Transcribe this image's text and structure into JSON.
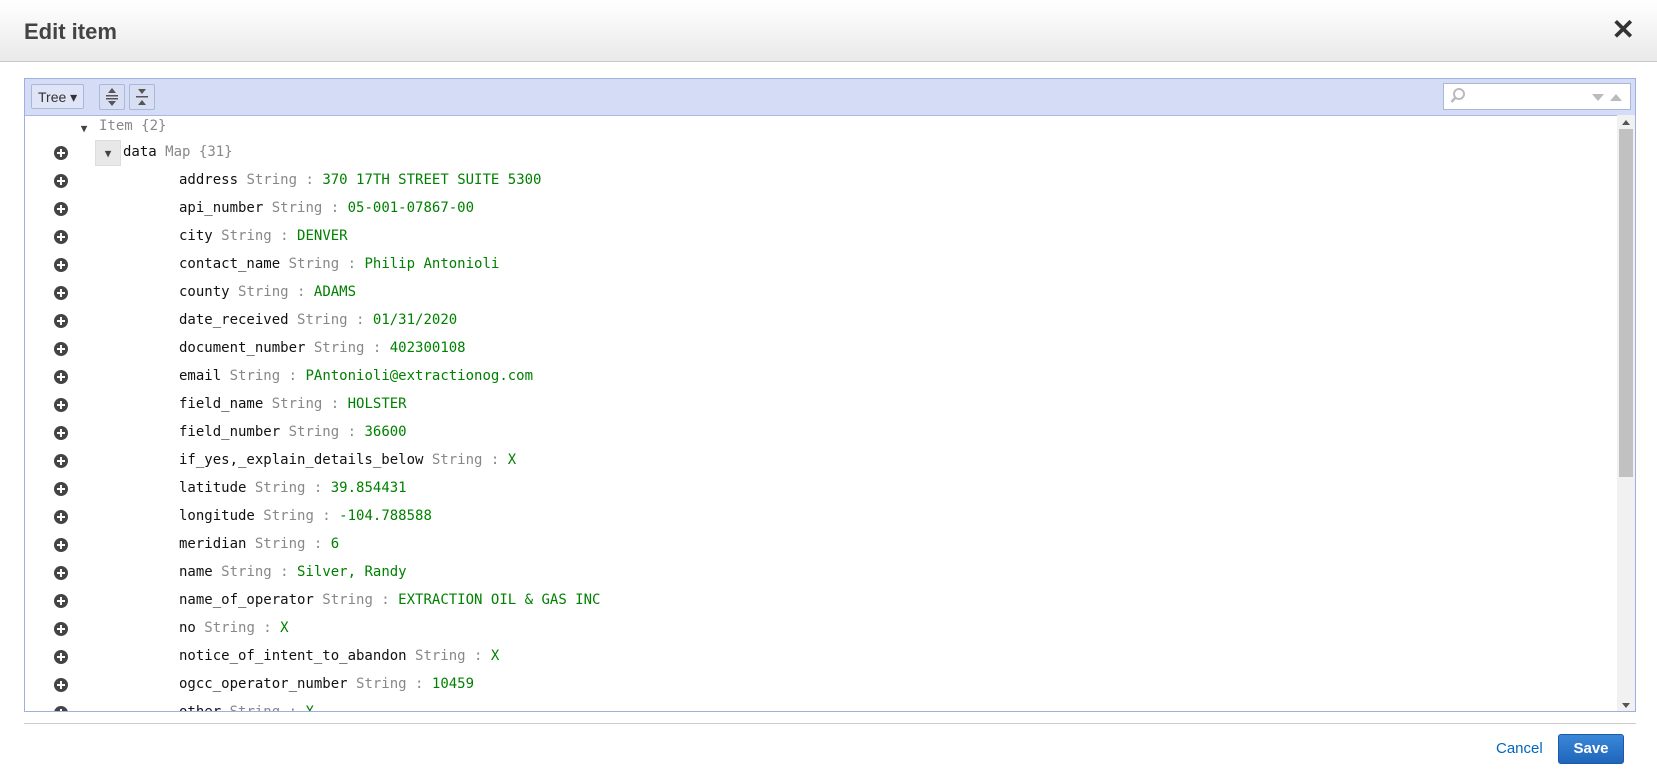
{
  "dialog": {
    "title": "Edit item",
    "close_label": "✕"
  },
  "toolbar": {
    "mode_label": "Tree ▾",
    "search_placeholder": ""
  },
  "tree": {
    "root": {
      "name": "Item",
      "count": "{2}"
    },
    "data_node": {
      "name": "data",
      "type": "Map",
      "count": "{31}"
    },
    "fields": [
      {
        "key": "address",
        "type": "String",
        "value": "370 17TH STREET SUITE 5300"
      },
      {
        "key": "api_number",
        "type": "String",
        "value": "05-001-07867-00"
      },
      {
        "key": "city",
        "type": "String",
        "value": "DENVER"
      },
      {
        "key": "contact_name",
        "type": "String",
        "value": "Philip Antonioli"
      },
      {
        "key": "county",
        "type": "String",
        "value": "ADAMS"
      },
      {
        "key": "date_received",
        "type": "String",
        "value": "01/31/2020"
      },
      {
        "key": "document_number",
        "type": "String",
        "value": "402300108"
      },
      {
        "key": "email",
        "type": "String",
        "value": "PAntonioli@extractionog.com"
      },
      {
        "key": "field_name",
        "type": "String",
        "value": "HOLSTER"
      },
      {
        "key": "field_number",
        "type": "String",
        "value": "36600"
      },
      {
        "key": "if_yes,_explain_details_below",
        "type": "String",
        "value": "X"
      },
      {
        "key": "latitude",
        "type": "String",
        "value": "39.854431"
      },
      {
        "key": "longitude",
        "type": "String",
        "value": "-104.788588"
      },
      {
        "key": "meridian",
        "type": "String",
        "value": "6"
      },
      {
        "key": "name",
        "type": "String",
        "value": "Silver, Randy"
      },
      {
        "key": "name_of_operator",
        "type": "String",
        "value": "EXTRACTION OIL & GAS INC"
      },
      {
        "key": "no",
        "type": "String",
        "value": "X"
      },
      {
        "key": "notice_of_intent_to_abandon",
        "type": "String",
        "value": "X"
      },
      {
        "key": "ogcc_operator_number",
        "type": "String",
        "value": "10459"
      },
      {
        "key": "other",
        "type": "String",
        "value": "X"
      }
    ]
  },
  "footer": {
    "cancel_label": "Cancel",
    "save_label": "Save"
  }
}
